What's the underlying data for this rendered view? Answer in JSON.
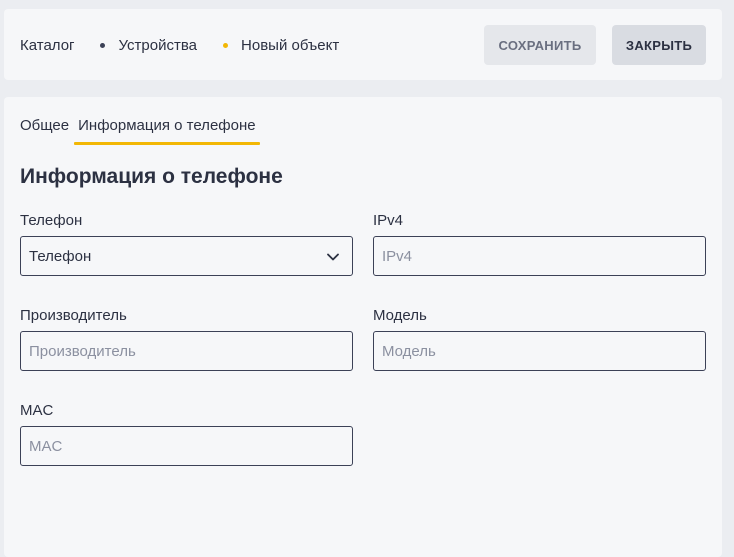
{
  "breadcrumb": {
    "items": [
      "Каталог",
      "Устройства",
      "Новый объект"
    ]
  },
  "toolbar": {
    "save_label": "СОХРАНИТЬ",
    "close_label": "ЗАКРЫТЬ"
  },
  "tabs": [
    {
      "label": "Общее",
      "active": false
    },
    {
      "label": "Информация о телефоне",
      "active": true
    }
  ],
  "section": {
    "title": "Информация о телефоне"
  },
  "fields": {
    "phone": {
      "label": "Телефон",
      "value": "Телефон"
    },
    "ipv4": {
      "label": "IPv4",
      "placeholder": "IPv4"
    },
    "manufacturer": {
      "label": "Производитель",
      "placeholder": "Производитель"
    },
    "model": {
      "label": "Модель",
      "placeholder": "Модель"
    },
    "mac": {
      "label": "MAC",
      "placeholder": "MAC"
    }
  },
  "icons": {
    "select_chevron": "chevron-down-icon"
  },
  "colors": {
    "accent": "#f2b705",
    "text": "#2c3142",
    "background": "#ebedf1",
    "surface": "#f6f7f9",
    "border": "#3c4157",
    "placeholder": "#8b90a0"
  }
}
